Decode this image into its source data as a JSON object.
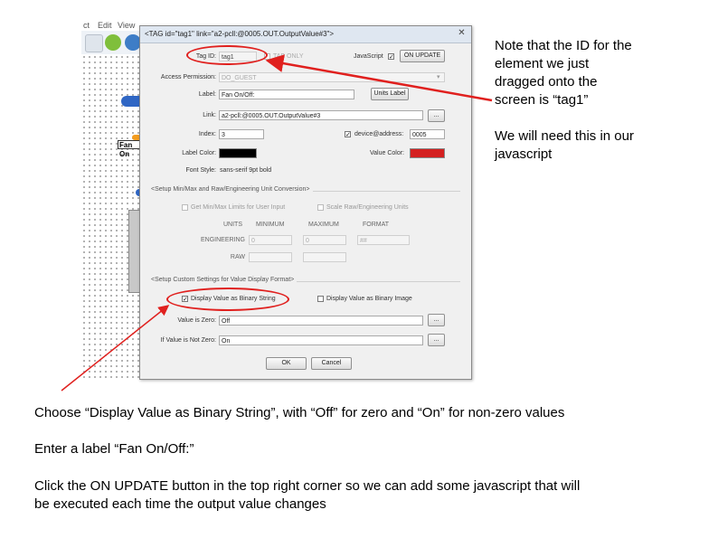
{
  "editor": {
    "menu": [
      "ct",
      "Edit",
      "View"
    ],
    "canvas_labels": {
      "fan_tag": "Fan On"
    }
  },
  "dialog": {
    "title": "<TAG id=\"tag1\" link=\"a2-pcll:@0005.OUT.OutputValue#3\">",
    "tag_id": {
      "label": "Tag ID:",
      "value": "tag1",
      "disabled_check": "TAB ONLY"
    },
    "javascript": {
      "label": "JavaScript",
      "checked": true,
      "button": "ON UPDATE"
    },
    "access_permission": {
      "label": "Access Permission:",
      "value": "DO_GUEST"
    },
    "label_field": {
      "label": "Label:",
      "value": "Fan On/Off:",
      "units_button": "Units Label"
    },
    "link": {
      "label": "Link:",
      "value": "a2-pcll:@0005.OUT.OutputValue#3",
      "browse": "..."
    },
    "index": {
      "label": "Index:",
      "value": "3"
    },
    "device_address": {
      "label": "device@address:",
      "checked": true,
      "value": "0005"
    },
    "label_color": {
      "label": "Label Color:",
      "color": "#000000"
    },
    "value_color": {
      "label": "Value Color:",
      "color": "#d42020"
    },
    "font_style": {
      "label": "Font Style:",
      "value": "sans-serif 9pt bold"
    },
    "units_section": {
      "title": "<Setup Min/Max and Raw/Engineering Unit Conversion>",
      "get_minmax": "Get Min/Max Limits for User Input",
      "scale_raw": "Scale Raw/Engineering Units",
      "col_units": "UNITS",
      "col_minimum": "MINIMUM",
      "col_maximum": "MAXIMUM",
      "col_format": "FORMAT",
      "row_engineering": "ENGINEERING",
      "row_raw": "RAW",
      "eng_units": "0",
      "eng_min": "0",
      "eng_format": "##"
    },
    "custom_section": {
      "title": "<Setup Custom Settings for Value Display Format>",
      "display_binary_string": {
        "label": "Display Value as Binary String",
        "checked": true
      },
      "display_binary_image": {
        "label": "Display Value as Binary Image",
        "checked": false
      },
      "value_is_zero": {
        "label": "Value is Zero:",
        "value": "Off"
      },
      "value_not_zero": {
        "label": "If Value is Not Zero:",
        "value": "On"
      }
    },
    "ok": "OK",
    "cancel": "Cancel"
  },
  "annotations": {
    "note_lines": [
      "Note that the ID for the",
      "element we just",
      "dragged onto the",
      "screen is “tag1”"
    ],
    "note2_lines": [
      "We will need this in our",
      "javascript"
    ],
    "instruction1": "Choose “Display Value as Binary String”, with “Off” for zero and “On” for non-zero values",
    "instruction2": "Enter a label “Fan On/Off:”",
    "instruction3_lines": [
      "Click the ON UPDATE button in the top right corner so we can add some javascript that will",
      "be executed each time the output value changes"
    ],
    "accent_color": "#e0201e"
  }
}
